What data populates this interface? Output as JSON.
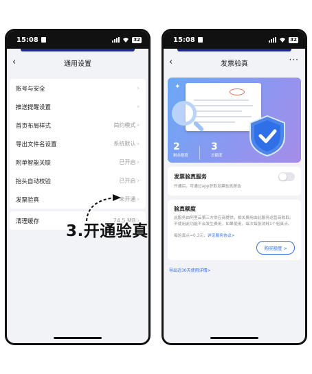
{
  "status": {
    "time": "15:08",
    "battery": "32"
  },
  "left": {
    "title": "通用设置",
    "items": [
      {
        "label": "账号与安全",
        "value": ""
      },
      {
        "label": "推送提醒设置",
        "value": ""
      },
      {
        "label": "首页布局样式",
        "value": "简约模式"
      },
      {
        "label": "导出文件名设置",
        "value": "系统默认"
      },
      {
        "label": "附单智能关联",
        "value": "已开启"
      },
      {
        "label": "抬头自动校验",
        "value": "已开启"
      },
      {
        "label": "发票验真",
        "value": "未开通"
      }
    ],
    "cache": {
      "label": "清理缓存",
      "value": "74.5 MB"
    },
    "annotation": "3.开通验真"
  },
  "right": {
    "title": "发票验真",
    "hero": {
      "remaining_count": "2",
      "remaining_label": "剩余额度",
      "total_count": "3",
      "total_label": "总额度"
    },
    "service": {
      "title": "发票验真服务",
      "desc": "开通后，可通过app获取发票验真报告",
      "enabled": false
    },
    "quota": {
      "title": "验真额度",
      "desc": "此服务由阿里云第三方供应商提供，相关费用由此服务运营商收取。不使用此功能不会发生费用，如果使用，每次每张消耗1个验真点。",
      "price": "每验真点=0.3元，",
      "agreement": "详见服务协议>",
      "buy_label": "购买额度 >"
    },
    "export_link": "导出近30天使用详情>"
  },
  "colors": {
    "accent": "#2f6fe8",
    "hero_start": "#6aa8f6",
    "hero_end": "#a58ce8",
    "nav_accent": "#1b2a8c"
  }
}
